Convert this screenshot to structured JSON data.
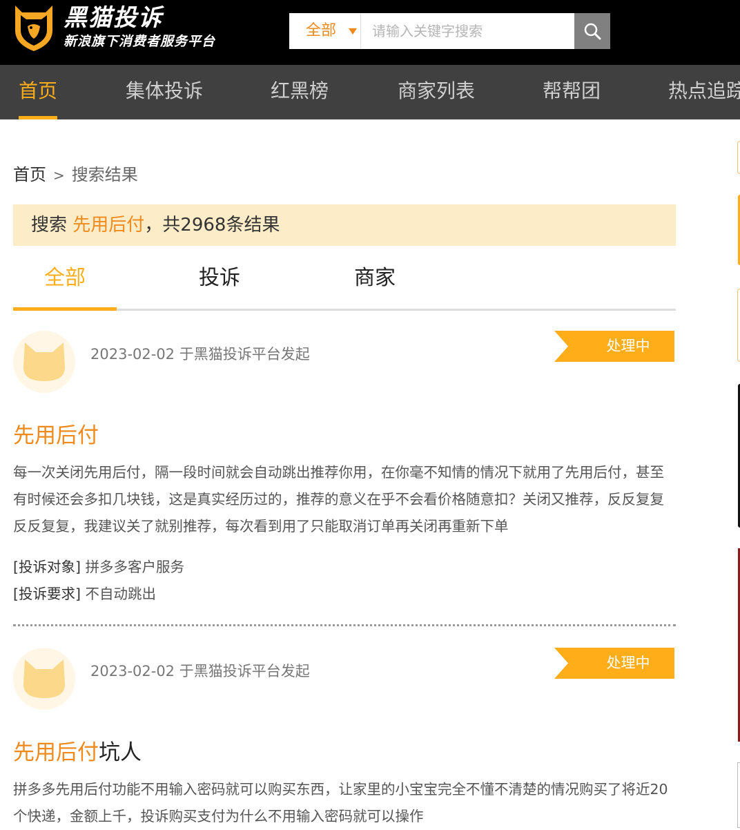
{
  "header": {
    "brand_title": "黑猫投诉",
    "brand_subtitle": "新浪旗下消费者服务平台",
    "search": {
      "scope": "全部",
      "placeholder": "请输入关键字搜索"
    }
  },
  "nav": {
    "items": [
      {
        "label": "首页",
        "active": true
      },
      {
        "label": "集体投诉"
      },
      {
        "label": "红黑榜"
      },
      {
        "label": "商家列表"
      },
      {
        "label": "帮帮团"
      },
      {
        "label": "热点追踪"
      }
    ]
  },
  "breadcrumb": {
    "home": "首页",
    "separator": ">",
    "current": "搜索结果"
  },
  "results": {
    "prefix": "搜索 ",
    "keyword": "先用后付",
    "suffix": "，共2968条结果"
  },
  "tabs": [
    {
      "label": "全部",
      "active": true
    },
    {
      "label": "投诉"
    },
    {
      "label": "商家"
    }
  ],
  "complaints": [
    {
      "meta": "2023-02-02 于黑猫投诉平台发起",
      "status": "处理中",
      "title_keyword": "先用后付",
      "title_rest": "",
      "body": "每一次关闭先用后付，隔一段时间就会自动跳出推荐你用，在你毫不知情的情况下就用了先用后付，甚至有时候还会多扣几块钱，这是真实经历过的，推荐的意义在乎不会看价格随意扣？关闭又推荐，反反复复反反复复，我建议关了就别推荐，每次看到用了只能取消订单再关闭再重新下单",
      "target_label": "[投诉对象]",
      "target_value": "拼多多客户服务",
      "demand_label": "[投诉要求]",
      "demand_value": "不自动跳出"
    },
    {
      "meta": "2023-02-02 于黑猫投诉平台发起",
      "status": "处理中",
      "title_keyword": "先用后付",
      "title_rest": "坑人",
      "body": "拼多多先用后付功能不用输入密码就可以购买东西，让家里的小宝宝完全不懂不清楚的情况购买了将近20个快递，金额上千，投诉购买支付为什么不用输入密码就可以操作"
    }
  ],
  "colors": {
    "accent": "#ffae1a",
    "keyword": "#f08a1c",
    "banner_bg": "#fdecc8",
    "nav_bg": "#404040",
    "header_bg": "#000000"
  }
}
